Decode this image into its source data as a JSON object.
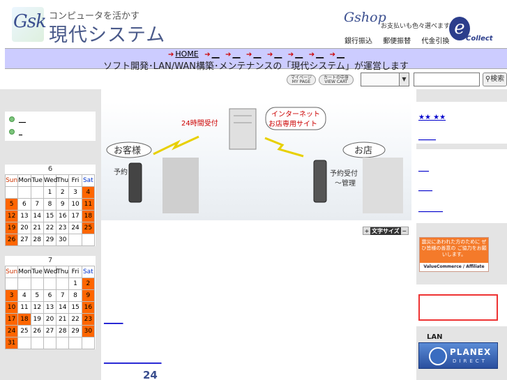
{
  "header": {
    "logo_text": "Gsk",
    "tagline": "コンピュータを活かす",
    "site_name": "現代システム",
    "shop_logo": "Gshop",
    "shop_text": "お支払いも色々選べます",
    "pay_methods": [
      "銀行振込",
      "郵便振替",
      "代金引換"
    ],
    "ecollect_letter": "e",
    "ecollect_text": "Collect"
  },
  "nav": {
    "home_label": "HOME",
    "links": [
      "__",
      "__",
      "__",
      "__",
      "__",
      "__",
      "__"
    ],
    "tagline": "ソフト開発･LAN/WAN構築･メンテナンスの「現代システム」が運営します"
  },
  "toolbar": {
    "mypage_label": "マイページ MY PAGE",
    "viewcart_label": "カートの中身 VIEW CART",
    "category_value": "",
    "search_value": "",
    "search_button": "検索"
  },
  "left_menu": {
    "items": [
      "__",
      "_"
    ]
  },
  "calendars": [
    {
      "month": "6",
      "weekdays": [
        "Sun",
        "Mon",
        "Tue",
        "Wed",
        "Thu",
        "Fri",
        "Sat"
      ],
      "weeks": [
        [
          "",
          "",
          "",
          "1",
          "2",
          "3",
          "4"
        ],
        [
          "5",
          "6",
          "7",
          "8",
          "9",
          "10",
          "11"
        ],
        [
          "12",
          "13",
          "14",
          "15",
          "16",
          "17",
          "18"
        ],
        [
          "19",
          "20",
          "21",
          "22",
          "23",
          "24",
          "25"
        ],
        [
          "26",
          "27",
          "28",
          "29",
          "30",
          "",
          ""
        ]
      ],
      "holidays": [
        "4",
        "5",
        "11",
        "12",
        "18",
        "19",
        "25",
        "26"
      ]
    },
    {
      "month": "7",
      "weekdays": [
        "Sun",
        "Mon",
        "Tue",
        "Wed",
        "Thu",
        "Fri",
        "Sat"
      ],
      "weeks": [
        [
          "",
          "",
          "",
          "",
          "",
          "1",
          "2"
        ],
        [
          "3",
          "4",
          "5",
          "6",
          "7",
          "8",
          "9"
        ],
        [
          "10",
          "11",
          "12",
          "13",
          "14",
          "15",
          "16"
        ],
        [
          "17",
          "18",
          "19",
          "20",
          "21",
          "22",
          "23"
        ],
        [
          "24",
          "25",
          "26",
          "27",
          "28",
          "29",
          "30"
        ],
        [
          "31",
          "",
          "",
          "",
          "",
          "",
          ""
        ]
      ],
      "holidays": [
        "2",
        "3",
        "9",
        "10",
        "16",
        "17",
        "18",
        "23",
        "24",
        "30",
        "31"
      ]
    }
  ],
  "banner": {
    "bubble_left": "お客様",
    "reception_24h": "24時間受付",
    "bubble_internet": "インターネット",
    "bubble_shop_site": "お店専用サイト",
    "bubble_shop": "お店",
    "reserve": "予約",
    "reserve_accept": "予約受付",
    "manage": "〜管理"
  },
  "font_size_label": "文字サイズ",
  "center": {
    "link1": "_____",
    "link2": "_______________",
    "number": "24"
  },
  "right": {
    "top_link": "★★ ★★",
    "link_a": "_____",
    "links": [
      "___",
      "____",
      "_______"
    ],
    "quake_banner_msg": "震災にあわれた方のために ぜひ皆様の善意の ご協力をお願いします。",
    "quake_banner_brand": "ValueCommerce / Affiliate",
    "lan_label": "LAN",
    "planex_name": "PLANEX",
    "planex_sub": "DIRECT"
  },
  "colors": {
    "nav_band": "#ccccff",
    "holiday": "#ff6600",
    "link": "#0000cc",
    "brand": "#3b4f8f"
  }
}
